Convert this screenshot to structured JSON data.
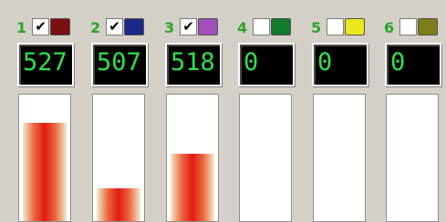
{
  "channels": [
    {
      "number": "1",
      "checked": true,
      "check_glyph": "✔",
      "swatch_color": "#7a1010",
      "value": "527",
      "level": 0.78
    },
    {
      "number": "2",
      "checked": true,
      "check_glyph": "✔",
      "swatch_color": "#1b2a8a",
      "value": "507",
      "level": 0.26
    },
    {
      "number": "3",
      "checked": true,
      "check_glyph": "✔",
      "swatch_color": "#a24fbc",
      "value": "518",
      "level": 0.53
    },
    {
      "number": "4",
      "checked": false,
      "check_glyph": "",
      "swatch_color": "#137a2e",
      "value": "0",
      "level": 0
    },
    {
      "number": "5",
      "checked": false,
      "check_glyph": "",
      "swatch_color": "#e8e81a",
      "value": "0",
      "level": 0
    },
    {
      "number": "6",
      "checked": false,
      "check_glyph": "",
      "swatch_color": "#7d7d1a",
      "value": "0",
      "level": 0
    }
  ],
  "colors": {
    "display_text": "#2fe04a",
    "channel_number": "#2aa52a",
    "bar_center": "#e01a12"
  }
}
